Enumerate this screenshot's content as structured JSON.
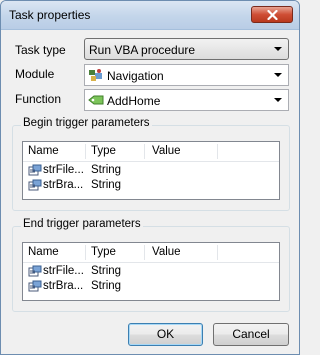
{
  "window": {
    "title": "Task properties"
  },
  "form": {
    "task_type": {
      "label": "Task type",
      "value": "Run VBA procedure"
    },
    "module": {
      "label": "Module",
      "value": "Navigation"
    },
    "function": {
      "label": "Function",
      "value": "AddHome"
    }
  },
  "begin_params": {
    "title": "Begin trigger parameters",
    "columns": [
      "Name",
      "Type",
      "Value"
    ],
    "rows": [
      {
        "name": "strFile...",
        "type": "String",
        "value": ""
      },
      {
        "name": "strBra...",
        "type": "String",
        "value": ""
      }
    ]
  },
  "end_params": {
    "title": "End trigger parameters",
    "columns": [
      "Name",
      "Type",
      "Value"
    ],
    "rows": [
      {
        "name": "strFile...",
        "type": "String",
        "value": ""
      },
      {
        "name": "strBra...",
        "type": "String",
        "value": ""
      }
    ]
  },
  "buttons": {
    "ok": "OK",
    "cancel": "Cancel"
  },
  "icons": {
    "close": "close-icon",
    "module": "module-icon",
    "function": "function-icon",
    "param": "parameter-icon"
  }
}
